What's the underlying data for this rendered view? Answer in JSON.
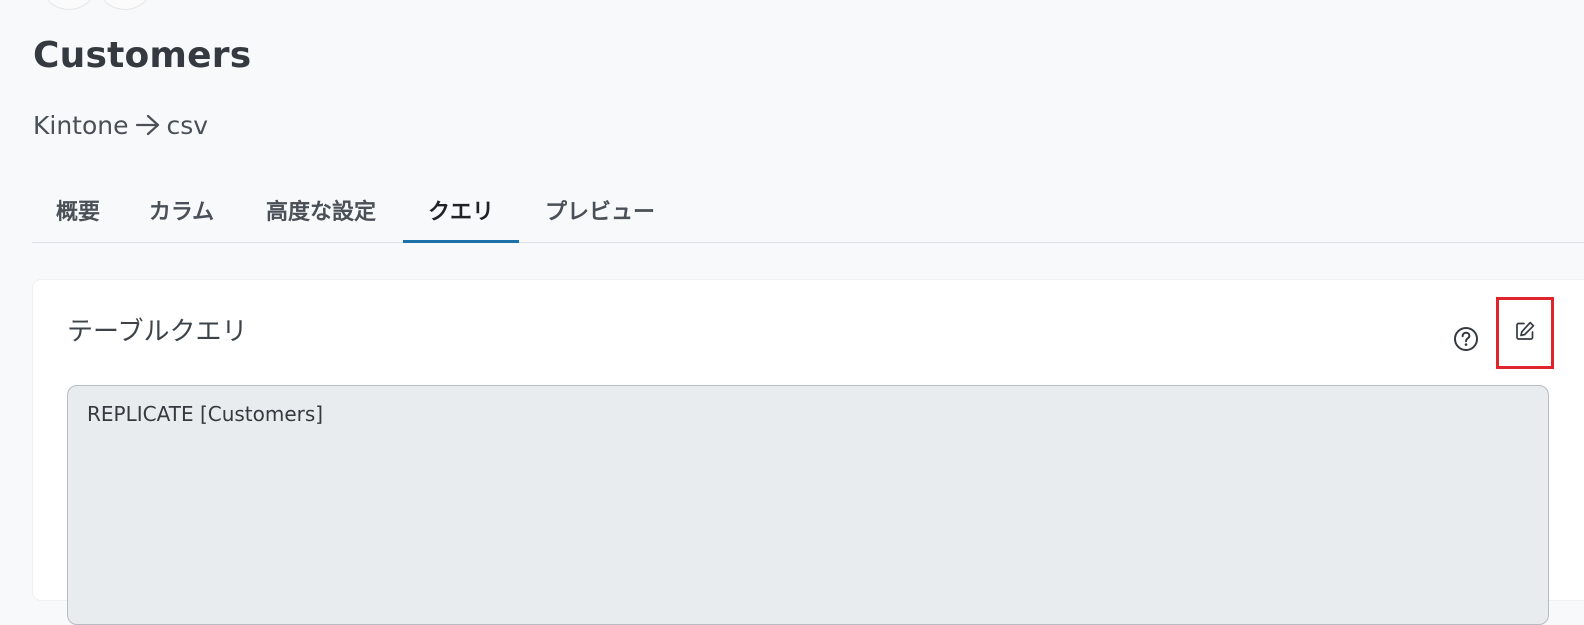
{
  "header": {
    "title": "Customers",
    "source": "Kintone",
    "destination": "csv"
  },
  "tabs": [
    {
      "label": "概要"
    },
    {
      "label": "カラム"
    },
    {
      "label": "高度な設定"
    },
    {
      "label": "クエリ",
      "active": true
    },
    {
      "label": "プレビュー"
    }
  ],
  "query_card": {
    "title": "テーブルクエリ",
    "help_icon": "help-circle-icon",
    "edit_icon": "edit-pencil-icon",
    "query_text": "REPLICATE [Customers]"
  },
  "colors": {
    "accent": "#1c72a8",
    "highlight_box": "#e0242b"
  }
}
